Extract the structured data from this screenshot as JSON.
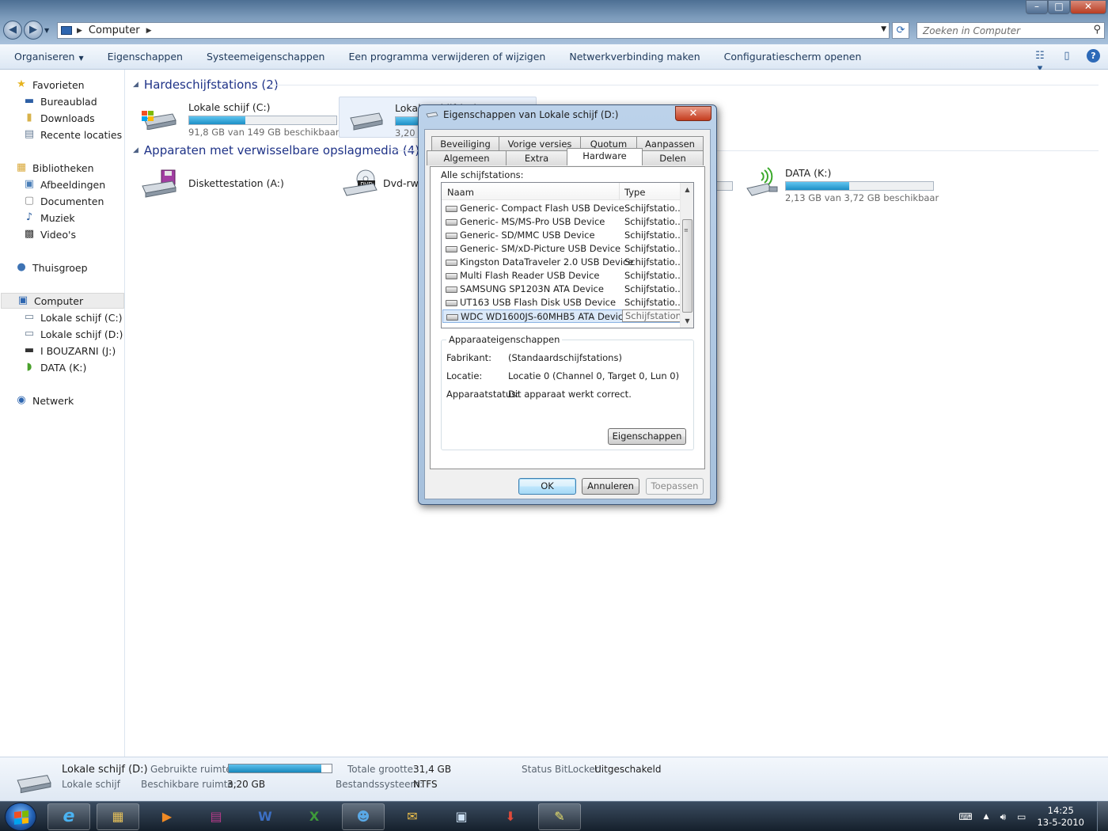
{
  "window": {
    "controls": [
      "–",
      "□",
      "✕"
    ],
    "address": "Computer",
    "search_placeholder": "Zoeken in Computer"
  },
  "commandbar": {
    "items": [
      "Organiseren",
      "Eigenschappen",
      "Systeemeigenschappen",
      "Een programma verwijderen of wijzigen",
      "Netwerkverbinding maken",
      "Configuratiescherm openen"
    ]
  },
  "navpane": {
    "favorites": "Favorieten",
    "fav_items": [
      "Bureaublad",
      "Downloads",
      "Recente locaties"
    ],
    "libraries": "Bibliotheken",
    "lib_items": [
      "Afbeeldingen",
      "Documenten",
      "Muziek",
      "Video's"
    ],
    "homegroup": "Thuisgroep",
    "computer": "Computer",
    "computer_items": [
      "Lokale schijf (C:)",
      "Lokale schijf (D:)",
      "I BOUZARNI (J:)",
      "DATA (K:)"
    ],
    "network": "Netwerk"
  },
  "content": {
    "group1": "Hardeschijfstations (2)",
    "group2": "Apparaten met verwisselbare opslagmedia (4)",
    "drives": [
      {
        "name": "Lokale schijf (C:)",
        "sub": "91,8 GB van 149 GB beschikbaar",
        "used_fraction": 0.38
      },
      {
        "name": "Lokale schijf (D:)",
        "sub": "3,20 GB",
        "used_fraction": 0.9
      }
    ],
    "removable": [
      {
        "name": "Diskettestation (A:)"
      },
      {
        "name": "Dvd-rw-",
        "badge": "DVD"
      },
      {
        "name": "DATA (K:)",
        "sub": "2,13 GB van 3,72 GB beschikbaar",
        "used_fraction": 0.43
      }
    ]
  },
  "details": {
    "title": "Lokale schijf (D:)",
    "subtitle": "Lokale schijf",
    "used_label": "Gebruikte ruimte:",
    "used_fraction": 0.9,
    "free_label": "Beschikbare ruimte:",
    "free_value": "3,20 GB",
    "total_label": "Totale grootte:",
    "total_value": "31,4 GB",
    "fs_label": "Bestandssysteem:",
    "fs_value": "NTFS",
    "bitlocker_label": "Status BitLocker:",
    "bitlocker_value": "Uitgeschakeld"
  },
  "taskbar": {
    "time": "14:25",
    "date": "13-5-2010"
  },
  "dialog": {
    "title": "Eigenschappen van Lokale schijf (D:)",
    "close": "✕",
    "tabs_row1": [
      "Beveiliging",
      "Vorige versies",
      "Quotum",
      "Aanpassen"
    ],
    "tabs_row2": [
      "Algemeen",
      "Extra",
      "Hardware",
      "Delen"
    ],
    "all_drives_label": "Alle schijfstations:",
    "col_name": "Naam",
    "col_type": "Type",
    "rows": [
      {
        "name": "Generic- Compact Flash USB Device",
        "type": "Schijfstatio..."
      },
      {
        "name": "Generic- MS/MS-Pro USB Device",
        "type": "Schijfstatio..."
      },
      {
        "name": "Generic- SD/MMC USB Device",
        "type": "Schijfstatio..."
      },
      {
        "name": "Generic- SM/xD-Picture USB Device",
        "type": "Schijfstatio..."
      },
      {
        "name": "Kingston DataTraveler 2.0 USB Device",
        "type": "Schijfstatio..."
      },
      {
        "name": "Multi Flash Reader USB Device",
        "type": "Schijfstatio..."
      },
      {
        "name": "SAMSUNG SP1203N ATA Device",
        "type": "Schijfstatio..."
      },
      {
        "name": "UT163 USB Flash Disk USB Device",
        "type": "Schijfstatio..."
      },
      {
        "name": "WDC WD1600JS-60MHB5 ATA Device",
        "type": "Schijfstations"
      }
    ],
    "props_legend": "Apparaateigenschappen",
    "manufacturer_label": "Fabrikant:",
    "manufacturer_value": "(Standaardschijfstations)",
    "location_label": "Locatie:",
    "location_value": "Locatie 0 (Channel 0, Target 0, Lun 0)",
    "status_label": "Apparaatstatus:",
    "status_value": "Dit apparaat werkt correct.",
    "props_button": "Eigenschappen",
    "ok": "OK",
    "cancel": "Annuleren",
    "apply": "Toepassen"
  }
}
